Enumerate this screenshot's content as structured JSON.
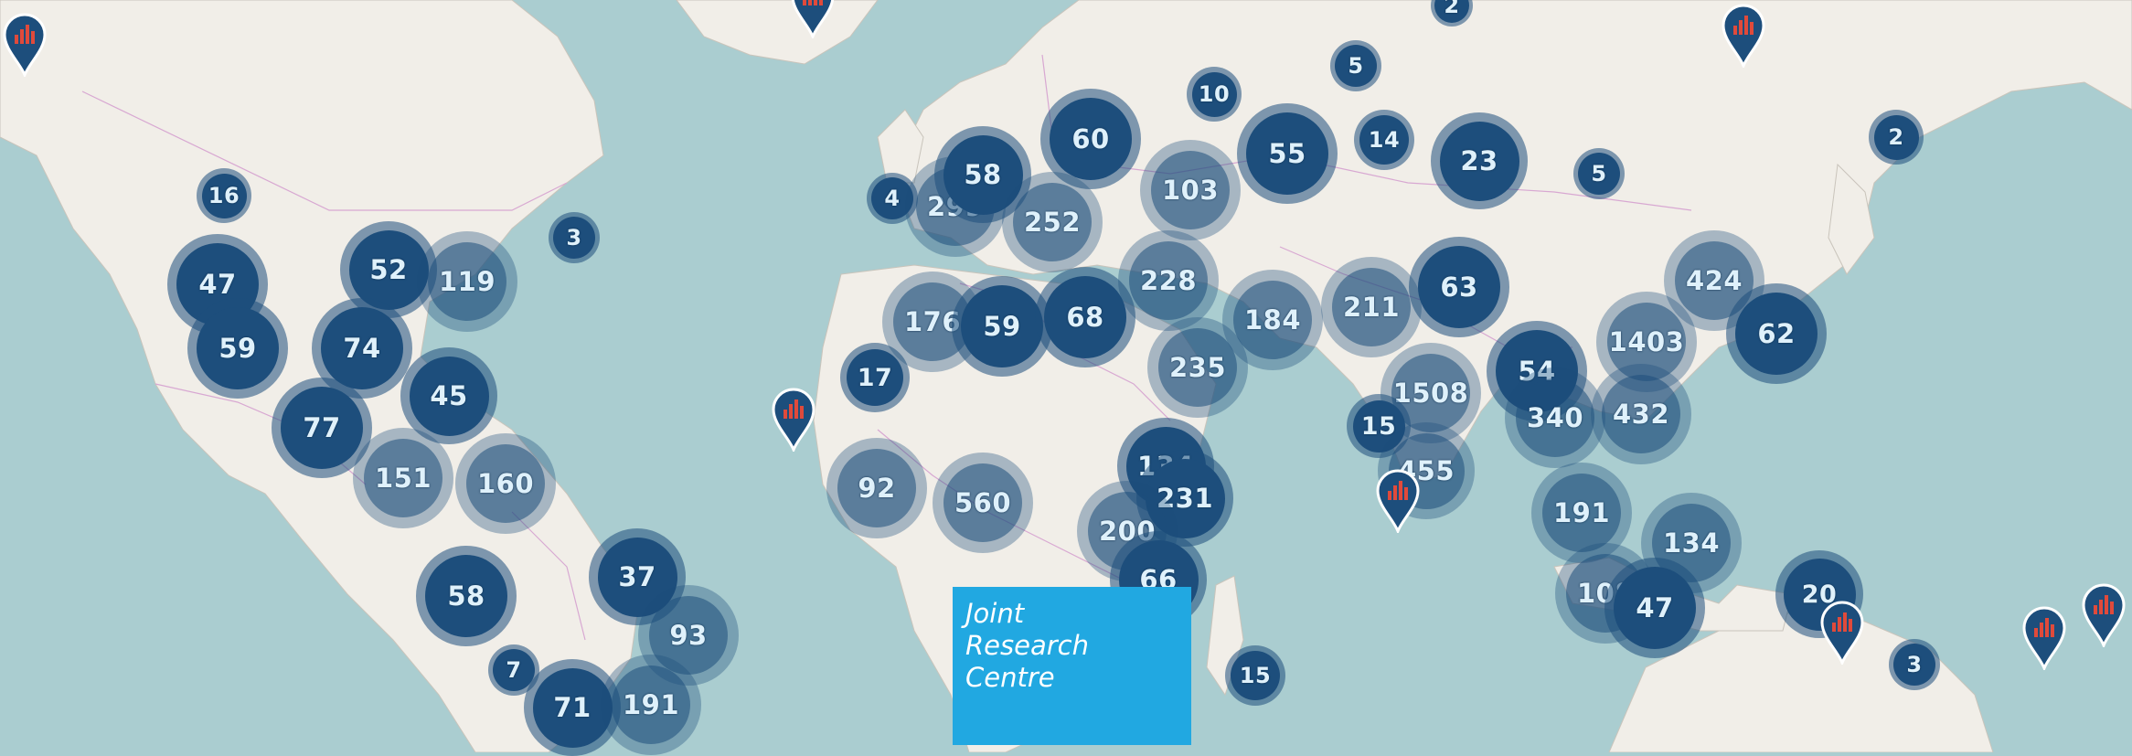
{
  "map": {
    "background": "#aacdd0",
    "cluster_color": "#1d4e7c",
    "label_color": "#dff1fb",
    "pin_color": "#1d4e7c",
    "pin_bar_color": "#e04a3b"
  },
  "clusters": [
    {
      "id": "alaska-2a",
      "label": "2",
      "tone": "dark"
    },
    {
      "id": "c16",
      "label": "16",
      "tone": "dark"
    },
    {
      "id": "c3na",
      "label": "3",
      "tone": "dark"
    },
    {
      "id": "c47",
      "label": "47",
      "tone": "dark"
    },
    {
      "id": "c52",
      "label": "52",
      "tone": "dark"
    },
    {
      "id": "c119",
      "label": "119",
      "tone": "light"
    },
    {
      "id": "c59",
      "label": "59",
      "tone": "dark"
    },
    {
      "id": "c74",
      "label": "74",
      "tone": "dark"
    },
    {
      "id": "c45",
      "label": "45",
      "tone": "dark"
    },
    {
      "id": "c77",
      "label": "77",
      "tone": "dark"
    },
    {
      "id": "c151",
      "label": "151",
      "tone": "light"
    },
    {
      "id": "c160",
      "label": "160",
      "tone": "light"
    },
    {
      "id": "c58sa",
      "label": "58",
      "tone": "dark"
    },
    {
      "id": "c37",
      "label": "37",
      "tone": "dark"
    },
    {
      "id": "c93",
      "label": "93",
      "tone": "light"
    },
    {
      "id": "c7",
      "label": "7",
      "tone": "dark"
    },
    {
      "id": "c71",
      "label": "71",
      "tone": "dark"
    },
    {
      "id": "c191sa",
      "label": "191",
      "tone": "light"
    },
    {
      "id": "c4",
      "label": "4",
      "tone": "dark"
    },
    {
      "id": "c299",
      "label": "299",
      "tone": "light"
    },
    {
      "id": "c58eu",
      "label": "58",
      "tone": "dark"
    },
    {
      "id": "c252",
      "label": "252",
      "tone": "light"
    },
    {
      "id": "c60",
      "label": "60",
      "tone": "dark"
    },
    {
      "id": "c10",
      "label": "10",
      "tone": "dark"
    },
    {
      "id": "c5a",
      "label": "5",
      "tone": "dark"
    },
    {
      "id": "c103",
      "label": "103",
      "tone": "light"
    },
    {
      "id": "c55",
      "label": "55",
      "tone": "dark"
    },
    {
      "id": "c14",
      "label": "14",
      "tone": "dark"
    },
    {
      "id": "c23",
      "label": "23",
      "tone": "dark"
    },
    {
      "id": "c5b",
      "label": "5",
      "tone": "dark"
    },
    {
      "id": "c2as",
      "label": "2",
      "tone": "dark"
    },
    {
      "id": "c228",
      "label": "228",
      "tone": "light"
    },
    {
      "id": "c176",
      "label": "176",
      "tone": "light"
    },
    {
      "id": "c59af",
      "label": "59",
      "tone": "dark"
    },
    {
      "id": "c68",
      "label": "68",
      "tone": "dark"
    },
    {
      "id": "c184",
      "label": "184",
      "tone": "light"
    },
    {
      "id": "c211",
      "label": "211",
      "tone": "light"
    },
    {
      "id": "c63",
      "label": "63",
      "tone": "dark"
    },
    {
      "id": "c424",
      "label": "424",
      "tone": "light"
    },
    {
      "id": "c1403",
      "label": "1403",
      "tone": "light"
    },
    {
      "id": "c62",
      "label": "62",
      "tone": "dark"
    },
    {
      "id": "c235",
      "label": "235",
      "tone": "light"
    },
    {
      "id": "c17",
      "label": "17",
      "tone": "dark"
    },
    {
      "id": "c1508",
      "label": "1508",
      "tone": "light"
    },
    {
      "id": "c54",
      "label": "54",
      "tone": "dark"
    },
    {
      "id": "c340",
      "label": "340",
      "tone": "light"
    },
    {
      "id": "c432",
      "label": "432",
      "tone": "light"
    },
    {
      "id": "c15a",
      "label": "15",
      "tone": "dark"
    },
    {
      "id": "c455",
      "label": "455",
      "tone": "light"
    },
    {
      "id": "c92",
      "label": "92",
      "tone": "light"
    },
    {
      "id": "c560",
      "label": "560",
      "tone": "light"
    },
    {
      "id": "c134af",
      "label": "134",
      "tone": "dark"
    },
    {
      "id": "c231",
      "label": "231",
      "tone": "dark"
    },
    {
      "id": "c200",
      "label": "200",
      "tone": "light"
    },
    {
      "id": "c66",
      "label": "66",
      "tone": "dark"
    },
    {
      "id": "c191as",
      "label": "191",
      "tone": "light"
    },
    {
      "id": "c134as",
      "label": "134",
      "tone": "light"
    },
    {
      "id": "c108",
      "label": "108",
      "tone": "light"
    },
    {
      "id": "c47as",
      "label": "47",
      "tone": "dark"
    },
    {
      "id": "c20",
      "label": "20",
      "tone": "dark"
    },
    {
      "id": "c15b",
      "label": "15",
      "tone": "dark"
    },
    {
      "id": "c3au",
      "label": "3",
      "tone": "dark"
    }
  ],
  "pins": [
    {
      "id": "pin-alaska"
    },
    {
      "id": "pin-iceland"
    },
    {
      "id": "pin-siberia"
    },
    {
      "id": "pin-atlantic"
    },
    {
      "id": "pin-india"
    },
    {
      "id": "pin-png"
    },
    {
      "id": "pin-pacific-a"
    },
    {
      "id": "pin-pacific-b"
    }
  ],
  "logo": {
    "line1": "Joint",
    "line2": "Research",
    "line3": "Centre",
    "background": "#21a8e1"
  }
}
